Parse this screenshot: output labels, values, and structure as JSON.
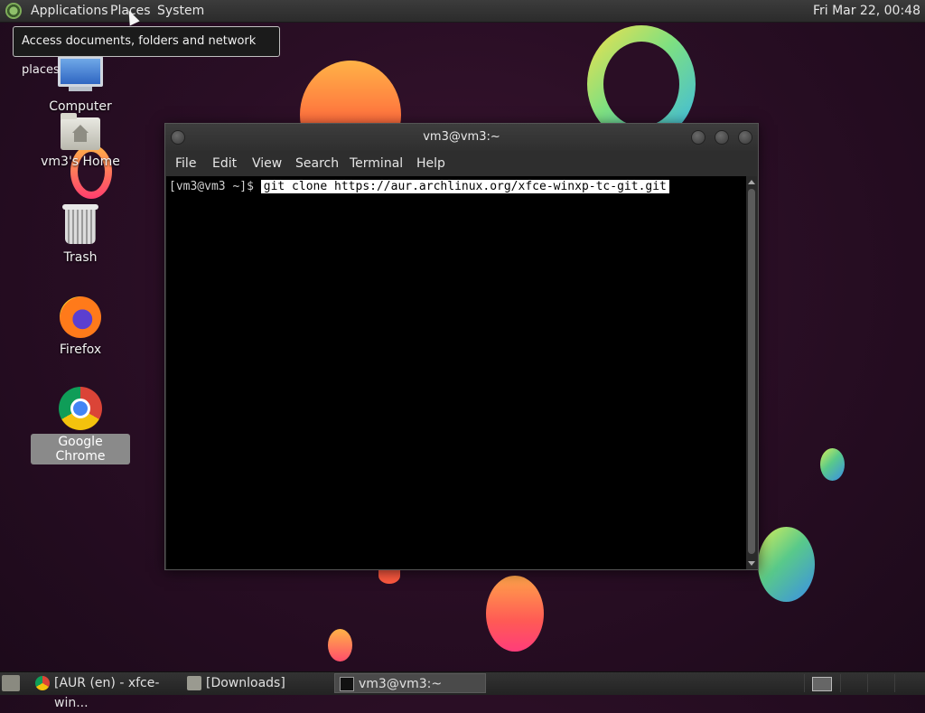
{
  "top_panel": {
    "menus": [
      "Applications",
      "Places",
      "System"
    ],
    "clock": "Fri Mar 22, 00:48"
  },
  "tooltip": "Access documents, folders and network places",
  "desktop_icons": [
    {
      "label": "Computer",
      "icon": "computer-icon"
    },
    {
      "label": "vm3's Home",
      "icon": "home-folder-icon"
    },
    {
      "label": "Trash",
      "icon": "trash-icon"
    },
    {
      "label": "Firefox",
      "icon": "firefox-icon"
    },
    {
      "label": "Google Chrome",
      "icon": "chrome-icon",
      "selected": true
    }
  ],
  "terminal": {
    "title": "vm3@vm3:~",
    "menu": [
      "File",
      "Edit",
      "View",
      "Search",
      "Terminal",
      "Help"
    ],
    "prompt": "[vm3@vm3 ~]$ ",
    "command": "git clone https://aur.archlinux.org/xfce-winxp-tc-git.git"
  },
  "taskbar": {
    "tasks": [
      {
        "label": "[AUR (en) - xfce-win...",
        "icon": "chrome-icon"
      },
      {
        "label": "[Downloads]",
        "icon": "folder-icon"
      },
      {
        "label": "vm3@vm3:~",
        "icon": "terminal-icon",
        "active": true
      }
    ]
  },
  "colors": {
    "wallpaper": "#2a0e25",
    "panel": "#2b2b2b",
    "terminal_bg": "#000000"
  }
}
